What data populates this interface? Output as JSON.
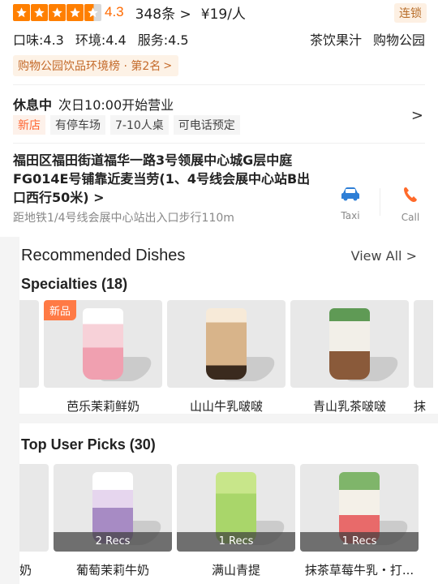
{
  "rating": {
    "value": "4.3",
    "stars_filled": 4,
    "stars_half": 1,
    "review_count": "348条",
    "price": "¥19/人",
    "chain_badge": "连锁"
  },
  "scores": [
    "口味:4.3",
    "环境:4.4",
    "服务:4.5"
  ],
  "categories": [
    "茶饮果汁",
    "购物公园"
  ],
  "rank_tag": "购物公园饮品环境榜 · 第2名",
  "hours": {
    "status": "休息中",
    "next_open": "次日10:00开始营业"
  },
  "tags": [
    "新店",
    "有停车场",
    "7-10人桌",
    "可电话预定"
  ],
  "address": "福田区福田街道福华一路3号领展中心城G层中庭FG014E号铺靠近麦当劳(1、4号线会展中心站B出口西行50米)",
  "metro": "距地铁1/4号线会展中心站出入口步行110m",
  "actions": {
    "taxi": "Taxi",
    "call": "Call"
  },
  "recommended": {
    "title": "Recommended Dishes",
    "view_all": "View All",
    "specialties_title": "Specialties (18)",
    "specialties": [
      {
        "name": "芭乐茉莉鲜奶",
        "badge": "新品",
        "color": "#f4b8c4"
      },
      {
        "name": "山山牛乳啵啵",
        "badge": "",
        "color": "#d8b48a"
      },
      {
        "name": "青山乳茶啵啵",
        "badge": "",
        "color": "#6a9a5c"
      },
      {
        "name": "抹",
        "badge": "",
        "color": "#d0d0d0"
      }
    ],
    "top_picks_title": "Top User Picks (30)",
    "top_picks": [
      {
        "name": "奶",
        "recs": "",
        "color": "#d0d0d0"
      },
      {
        "name": "葡萄茉莉牛奶",
        "recs": "2 Recs",
        "color": "#a78bc4"
      },
      {
        "name": "满山青提",
        "recs": "1 Recs",
        "color": "#a9d66a"
      },
      {
        "name": "抹茶草莓牛乳・打...",
        "recs": "1 Recs",
        "color": "#7fb56a"
      }
    ]
  }
}
